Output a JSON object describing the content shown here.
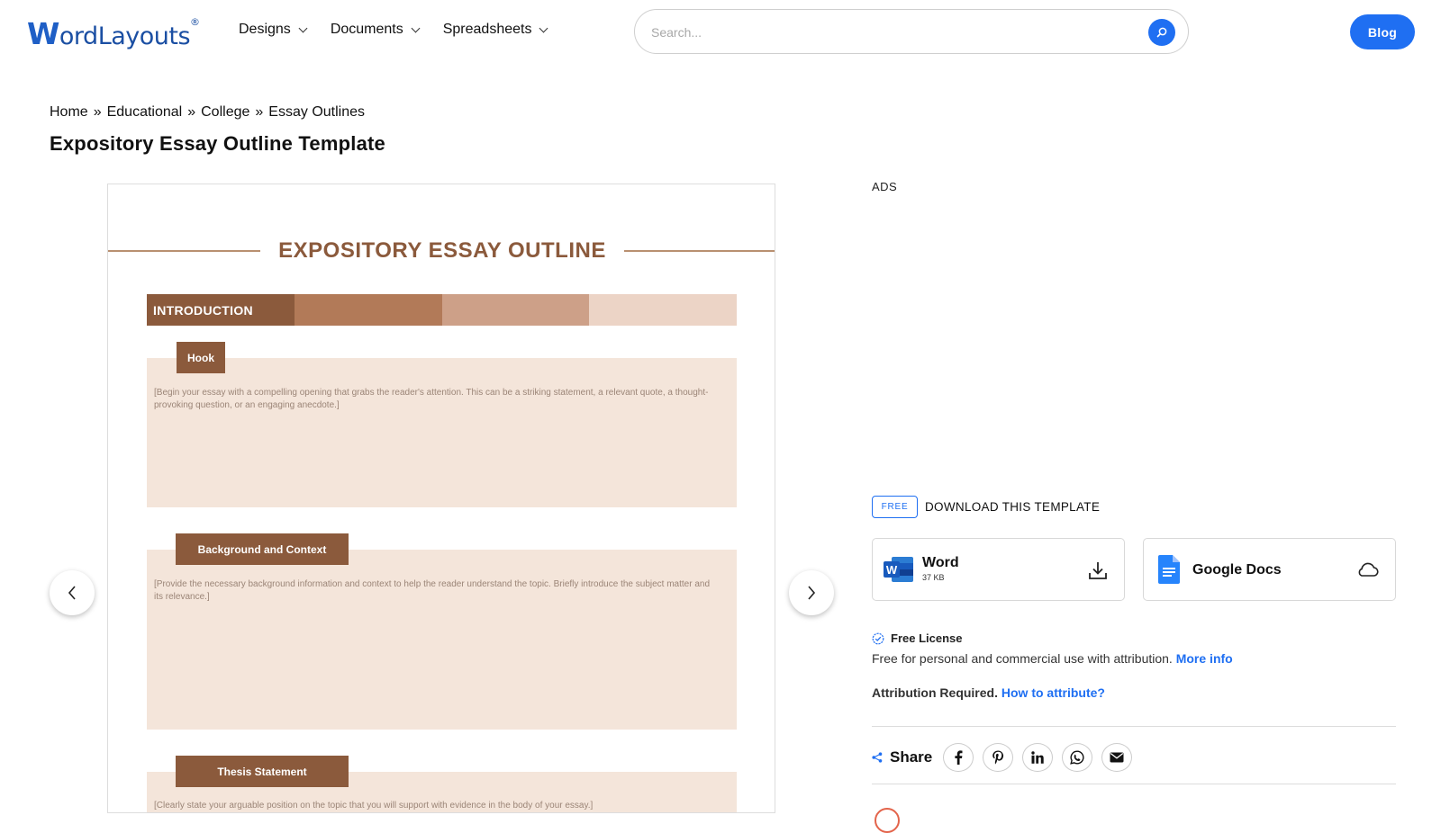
{
  "header": {
    "logo_text": "ordLayouts",
    "logo_letter": "W",
    "logo_mark": "®",
    "nav": [
      {
        "label": "Designs"
      },
      {
        "label": "Documents"
      },
      {
        "label": "Spreadsheets"
      }
    ],
    "search_placeholder": "Search...",
    "blog_label": "Blog"
  },
  "breadcrumb": {
    "items": [
      "Home",
      "Educational",
      "College",
      "Essay Outlines"
    ],
    "separator": "»"
  },
  "page_title": "Expository Essay Outline Template",
  "preview": {
    "doc_title": "EXPOSITORY ESSAY OUTLINE",
    "intro_label": "INTRODUCTION",
    "intro_colors": [
      "#8b5a3c",
      "#b27a58",
      "#cda088",
      "#ecd4c6"
    ],
    "sections": [
      {
        "tag": "Hook",
        "text": "[Begin your essay with a compelling opening that grabs the reader's attention. This can be a striking statement, a relevant quote, a thought-provoking question, or an engaging anecdote.]"
      },
      {
        "tag": "Background and Context",
        "text": "[Provide the necessary background information and context to help the reader understand the topic. Briefly introduce the subject matter and its relevance.]"
      },
      {
        "tag": "Thesis Statement",
        "text": "[Clearly state your arguable position on the topic that you will support with evidence in the body of your essay.]"
      }
    ]
  },
  "sidebar": {
    "ads_label": "ADS",
    "free_badge": "FREE",
    "download_heading": "DOWNLOAD THIS TEMPLATE",
    "word": {
      "name": "Word",
      "size": "37 KB"
    },
    "gdocs": {
      "name": "Google Docs"
    },
    "license_title": "Free License",
    "license_text": "Free for personal and commercial use with attribution.",
    "more_info": "More info",
    "attribution_label": "Attribution Required.",
    "attribution_link": "How to attribute?",
    "share_label": "Share",
    "share_icons": [
      "facebook-icon",
      "pinterest-icon",
      "linkedin-icon",
      "whatsapp-icon",
      "email-icon"
    ]
  },
  "colors": {
    "accent": "#1f6ff2",
    "brand": "#1b4fa3",
    "doc_brown": "#8b5a3c",
    "doc_box": "#f4e5da"
  }
}
